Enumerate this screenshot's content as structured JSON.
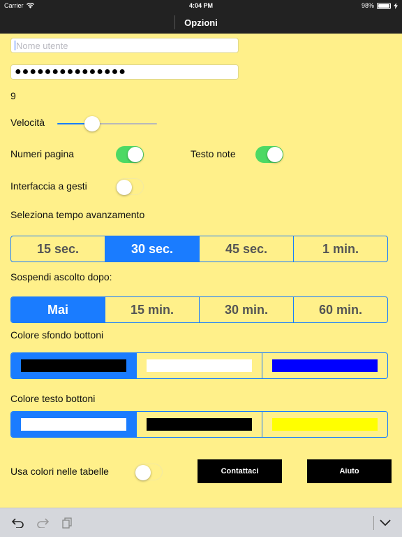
{
  "status": {
    "carrier": "Carrier",
    "time": "4:04 PM",
    "battery": "98%",
    "battery_level": 0.98
  },
  "nav": {
    "title": "Opzioni"
  },
  "fields": {
    "username_placeholder": "Nome utente",
    "username_value": "",
    "password_dots": "●●●●●●●●●●●●●●●"
  },
  "number_value": "9",
  "speed": {
    "label": "Velocità",
    "value": 0.35
  },
  "toggles": {
    "page_numbers": {
      "label": "Numeri pagina",
      "on": true
    },
    "notes_text": {
      "label": "Testo note",
      "on": true
    },
    "gesture_ui": {
      "label": "Interfaccia a gesti",
      "on": false
    },
    "table_colors": {
      "label": "Usa colori nelle tabelle",
      "on": false
    }
  },
  "advance_time": {
    "label": "Seleziona tempo avanzamento",
    "options": [
      "15 sec.",
      "30 sec.",
      "45 sec.",
      "1 min."
    ],
    "selected": 1
  },
  "suspend_after": {
    "label": "Sospendi ascolto dopo:",
    "options": [
      "Mai",
      "15 min.",
      "30 min.",
      "60 min."
    ],
    "selected": 0
  },
  "button_bg_color": {
    "label": "Colore sfondo bottoni",
    "swatches": [
      "#000000",
      "#ffffff",
      "#0000ff"
    ],
    "selected": 0
  },
  "button_text_color": {
    "label": "Colore testo bottoni",
    "swatches": [
      "#ffffff",
      "#000000",
      "#ffff00"
    ],
    "selected": 0
  },
  "buttons": {
    "contact": "Contattaci",
    "help": "Aiuto"
  },
  "colors": {
    "background": "#fff08a",
    "accent": "#1a7cff",
    "toggle_on": "#4cd964",
    "bar": "#222222"
  },
  "toolbar_icons": [
    "undo-icon",
    "redo-icon",
    "copy-icon",
    "chevron-down-icon"
  ]
}
